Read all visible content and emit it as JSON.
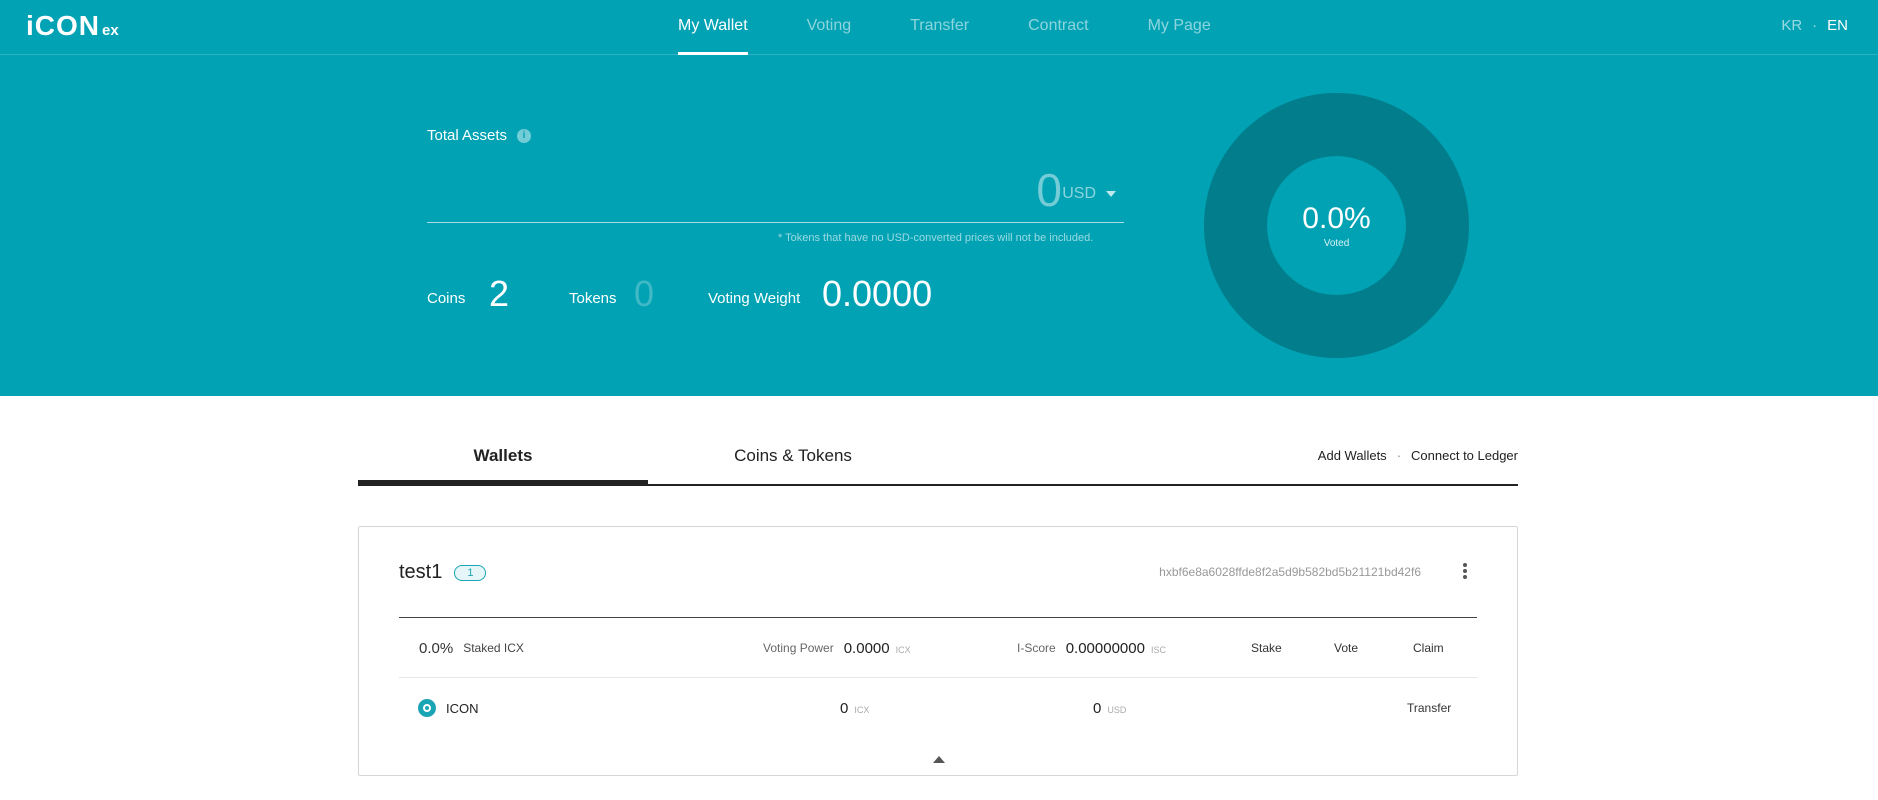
{
  "logo": {
    "main": "iCON",
    "sub": "ex"
  },
  "nav": [
    {
      "label": "My Wallet",
      "active": true
    },
    {
      "label": "Voting",
      "active": false
    },
    {
      "label": "Transfer",
      "active": false
    },
    {
      "label": "Contract",
      "active": false
    },
    {
      "label": "My Page",
      "active": false
    }
  ],
  "lang": {
    "kr": "KR",
    "separator": "·",
    "en": "EN"
  },
  "hero": {
    "total_assets_label": "Total Assets",
    "info_icon": "i",
    "total_value": "0",
    "currency": "USD",
    "note": "* Tokens that have no USD-converted prices will not be included.",
    "coins_label": "Coins",
    "coins_value": "2",
    "tokens_label": "Tokens",
    "tokens_value": "0",
    "voting_weight_label": "Voting Weight",
    "voting_weight_value": "0.0000",
    "donut": {
      "percent": "0.0%",
      "label": "Voted",
      "voted_fraction": 0.0
    }
  },
  "tabs": {
    "wallets": "Wallets",
    "coins_tokens": "Coins & Tokens",
    "add_wallets": "Add Wallets",
    "separator": "·",
    "connect_ledger": "Connect to Ledger"
  },
  "wallet": {
    "name": "test1",
    "badge": "1",
    "address": "hxbf6e8a6028ffde8f2a5d9b582bd5b21121bd42f6",
    "summary": {
      "staked_pct": "0.0%",
      "staked_label": "Staked ICX",
      "voting_power_label": "Voting Power",
      "voting_power_value": "0.0000",
      "voting_power_unit": "ICX",
      "iscore_label": "I-Score",
      "iscore_value": "0.00000000",
      "iscore_unit": "ISC",
      "stake": "Stake",
      "vote": "Vote",
      "claim": "Claim"
    },
    "coins": [
      {
        "name": "ICON",
        "amount": "0",
        "amount_unit": "ICX",
        "usd": "0",
        "usd_unit": "USD",
        "action": "Transfer"
      }
    ]
  }
}
